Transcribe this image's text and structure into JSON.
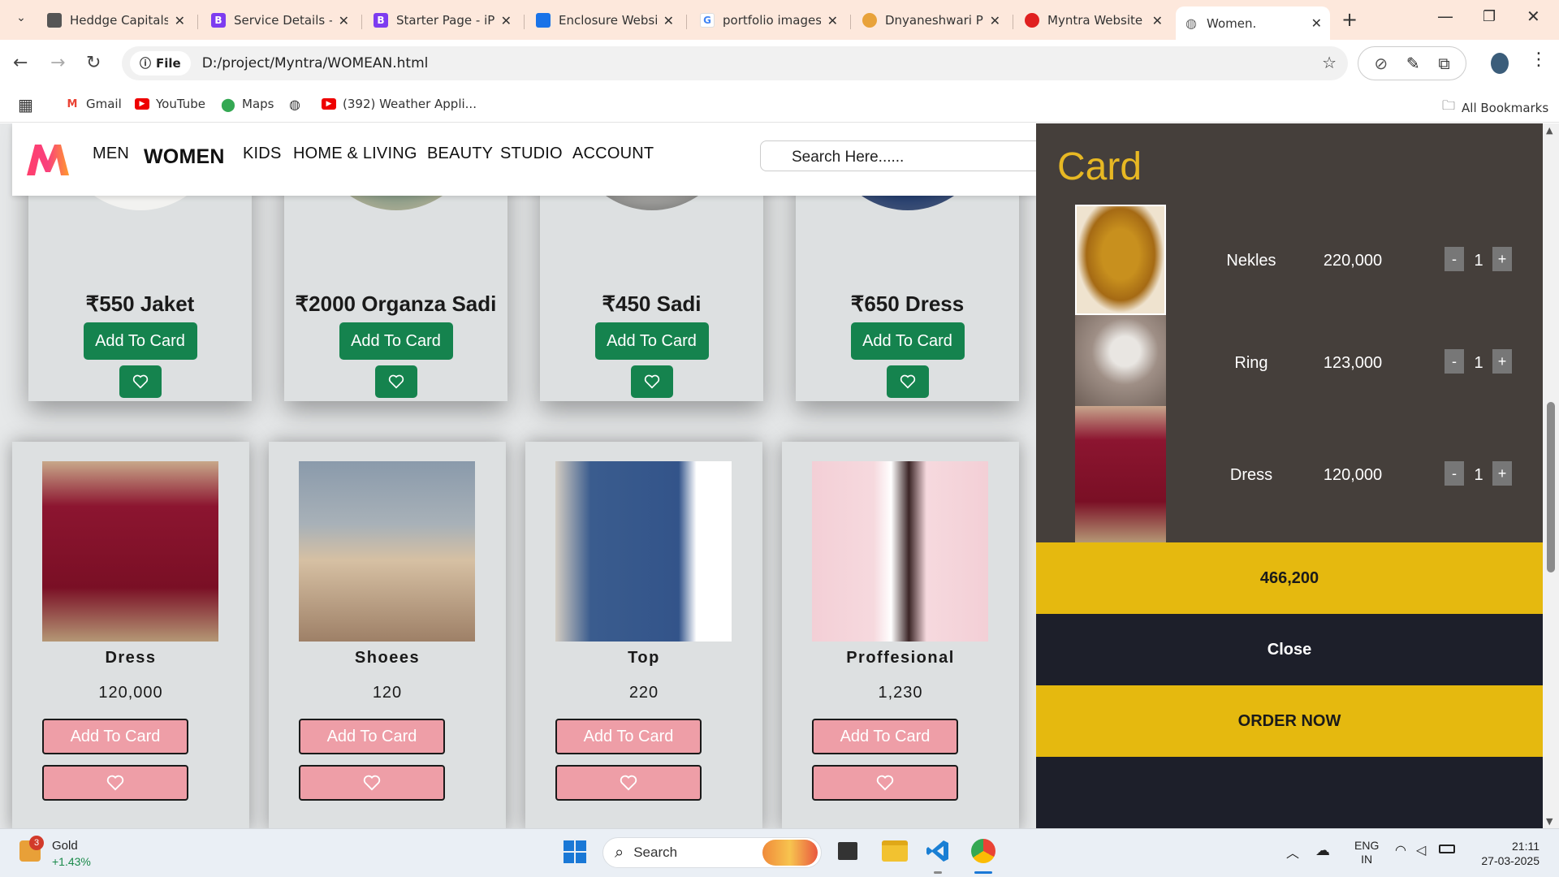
{
  "browser": {
    "tabs": [
      {
        "title": "Heddge Capitals",
        "favicon": "#555"
      },
      {
        "title": "Service Details -",
        "favicon": "#7d3cf0"
      },
      {
        "title": "Starter Page - iP",
        "favicon": "#7d3cf0"
      },
      {
        "title": "Enclosure Websit",
        "favicon": "#1a73e8"
      },
      {
        "title": "portfolio images",
        "favicon": "#4285f4"
      },
      {
        "title": "Dnyaneshwari P",
        "favicon": "#e8a23a"
      },
      {
        "title": "Myntra Website",
        "favicon": "#e02020"
      },
      {
        "title": "Women.",
        "favicon": "#666"
      }
    ],
    "address_chip": "File",
    "url": "D:/project/Myntra/WOMEAN.html",
    "bookmarks": [
      "Gmail",
      "YouTube",
      "Maps",
      "(392) Weather Appli...",
      "All Bookmarks"
    ]
  },
  "site": {
    "nav": [
      "MEN",
      "WOMEN",
      "KIDS",
      "HOME & LIVING",
      "BEAUTY",
      "STUDIO",
      "ACCOUNT"
    ],
    "search_placeholder": "Search Here......",
    "row1": [
      {
        "name": "₹550 Jaket",
        "button": "Add To Card"
      },
      {
        "name": "₹2000 Organza Sadi",
        "button": "Add To Card"
      },
      {
        "name": "₹450 Sadi",
        "button": "Add To Card"
      },
      {
        "name": "₹650 Dress",
        "button": "Add To Card"
      }
    ],
    "row2": [
      {
        "name": "Dress",
        "price": "120,000",
        "button": "Add To Card"
      },
      {
        "name": "Shoees",
        "price": "120",
        "button": "Add To Card"
      },
      {
        "name": "Top",
        "price": "220",
        "button": "Add To Card"
      },
      {
        "name": "Proffesional",
        "price": "1,230",
        "button": "Add To Card"
      }
    ]
  },
  "cart": {
    "title": "Card",
    "items": [
      {
        "name": "Nekles",
        "price": "220,000",
        "qty": "1"
      },
      {
        "name": "Ring",
        "price": "123,000",
        "qty": "1"
      },
      {
        "name": "Dress",
        "price": "120,000",
        "qty": "1"
      }
    ],
    "total": "466,200",
    "close_label": "Close",
    "order_label": "ORDER NOW",
    "minus": "-",
    "plus": "+"
  },
  "taskbar": {
    "stock_name": "Gold",
    "stock_change": "+1.43%",
    "badge": "3",
    "search_label": "Search",
    "lang_line1": "ENG",
    "lang_line2": "IN",
    "time": "21:11",
    "date": "27-03-2025"
  },
  "colors": {
    "accent_green": "#15834e",
    "cart_gold": "#e5b90f",
    "pink_button": "#ee9ea7",
    "cart_bg": "#453f3b"
  }
}
